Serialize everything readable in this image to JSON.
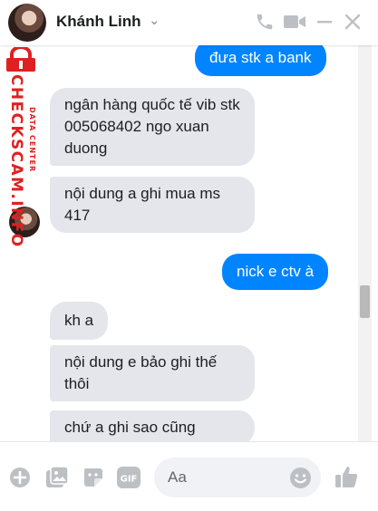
{
  "header": {
    "title": "Khánh Linh"
  },
  "watermark": {
    "brand": "CHECKSCAM.INFO",
    "sub": "DATA CENTER"
  },
  "messages": [
    {
      "side": "out",
      "text": "đưa stk a bank"
    },
    {
      "side": "in",
      "text": "ngân hàng quốc tế vib stk 005068402 ngo xuan duong"
    },
    {
      "side": "in",
      "text": "nội dung a ghi mua ms 417"
    },
    {
      "side": "out",
      "text": "nick e ctv à"
    },
    {
      "side": "in",
      "text": "kh a"
    },
    {
      "side": "in",
      "text": "nội dung e bảo ghi thế thôi"
    },
    {
      "side": "in",
      "text": "chứ a ghi sao cũng"
    }
  ],
  "composer": {
    "placeholder": "Aa"
  },
  "colors": {
    "outgoing": "#0084ff",
    "incoming": "#e4e6eb",
    "icons": "#bcc0c4"
  }
}
